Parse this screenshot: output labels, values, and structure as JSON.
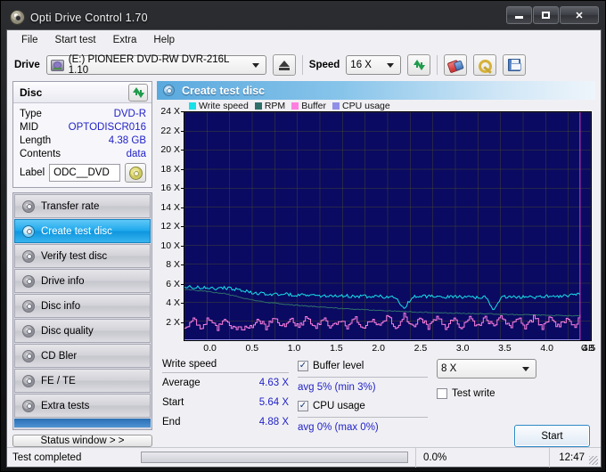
{
  "window": {
    "title": "Opti Drive Control 1.70",
    "minimize": "–",
    "maximize": "□",
    "close": "✕"
  },
  "menu": [
    {
      "label": "File"
    },
    {
      "label": "Start test"
    },
    {
      "label": "Extra"
    },
    {
      "label": "Help"
    }
  ],
  "toolbar": {
    "drive_label": "Drive",
    "drive_value": "(E:)  PIONEER DVD-RW  DVR-216L 1.10",
    "eject_icon": "eject-icon",
    "speed_label": "Speed",
    "speed_value": "16 X",
    "refresh_icon": "refresh-icon",
    "erase_icon": "erase-icon",
    "tools_icon": "tools-icon",
    "save_icon": "save-icon"
  },
  "disc": {
    "header": "Disc",
    "refresh_icon": "refresh-icon",
    "rows": [
      {
        "key": "Type",
        "value": "DVD-R"
      },
      {
        "key": "MID",
        "value": "OPTODISCR016"
      },
      {
        "key": "Length",
        "value": "4.38 GB"
      },
      {
        "key": "Contents",
        "value": "data"
      }
    ],
    "label_key": "Label",
    "label_value": "ODC__DVD",
    "cd_icon": "cd-disc-icon"
  },
  "nav": {
    "items": [
      {
        "label": "Transfer rate",
        "active": false
      },
      {
        "label": "Create test disc",
        "active": true
      },
      {
        "label": "Verify test disc",
        "active": false
      },
      {
        "label": "Drive info",
        "active": false
      },
      {
        "label": "Disc info",
        "active": false
      },
      {
        "label": "Disc quality",
        "active": false
      },
      {
        "label": "CD Bler",
        "active": false
      },
      {
        "label": "FE / TE",
        "active": false
      },
      {
        "label": "Extra tests",
        "active": false
      }
    ],
    "status_window": "Status window > >"
  },
  "main": {
    "header_title": "Create test disc",
    "header_icon": "disc-icon"
  },
  "stats": {
    "write_speed_title": "Write speed",
    "rows": [
      {
        "key": "Average",
        "value": "4.63 X"
      },
      {
        "key": "Start",
        "value": "5.64 X"
      },
      {
        "key": "End",
        "value": "4.88 X"
      }
    ],
    "buffer_label": "Buffer level",
    "buffer_checked": true,
    "buffer_note": "avg 5% (min 3%)",
    "cpu_label": "CPU usage",
    "cpu_checked": true,
    "cpu_note": "avg 0% (max 0%)",
    "speed_select": "8 X",
    "test_write_label": "Test write",
    "test_write_checked": false,
    "start_button": "Start"
  },
  "statusbar": {
    "text": "Test completed",
    "percent": "0.0%",
    "time": "12:47",
    "progress": 0
  },
  "chart_data": {
    "type": "line",
    "title": "Create test disc",
    "xlabel": "GB",
    "ylabel": "X",
    "xlim": [
      0.0,
      4.5
    ],
    "ylim": [
      0,
      24
    ],
    "xticks": [
      0.0,
      0.5,
      1.0,
      1.5,
      2.0,
      2.5,
      3.0,
      3.5,
      4.0,
      4.5
    ],
    "xtick_labels": [
      "0.0",
      "0.5",
      "1.0",
      "1.5",
      "2.0",
      "2.5",
      "3.0",
      "3.5",
      "4.0",
      "4.5"
    ],
    "x_unit": "GB",
    "yticks": [
      2,
      4,
      6,
      8,
      10,
      12,
      14,
      16,
      18,
      20,
      22,
      24
    ],
    "ytick_labels": [
      "2 X",
      "4 X",
      "6 X",
      "8 X",
      "10 X",
      "12 X",
      "14 X",
      "16 X",
      "18 X",
      "20 X",
      "22 X",
      "24 X"
    ],
    "grid": true,
    "plot_background": "#0a0a62",
    "grid_color": "#5a5a1e",
    "legend_position": "top",
    "end_marker_gb": 4.38,
    "end_marker_color": "#e040c0",
    "series": [
      {
        "name": "Write speed",
        "color": "#18e0e8",
        "unit": "X",
        "x": [
          0.0,
          0.09,
          0.18,
          0.27,
          0.36,
          0.45,
          0.54,
          0.63,
          0.72,
          0.81,
          0.9,
          0.99,
          1.08,
          1.17,
          1.26,
          1.35,
          1.44,
          1.53,
          1.62,
          1.71,
          1.8,
          1.89,
          1.98,
          2.07,
          2.16,
          2.25,
          2.34,
          2.43,
          2.52,
          2.61,
          2.7,
          2.79,
          2.88,
          2.97,
          3.06,
          3.15,
          3.24,
          3.33,
          3.42,
          3.51,
          3.6,
          3.69,
          3.78,
          3.87,
          3.96,
          4.05,
          4.14,
          4.23,
          4.32,
          4.38
        ],
        "values": [
          5.64,
          5.6,
          5.52,
          5.58,
          5.45,
          5.5,
          5.4,
          5.3,
          5.05,
          4.95,
          4.85,
          4.8,
          4.9,
          4.78,
          4.7,
          4.82,
          4.75,
          4.65,
          4.72,
          4.6,
          4.68,
          4.58,
          4.66,
          4.55,
          4.62,
          4.52,
          4.6,
          3.3,
          4.55,
          4.7,
          4.6,
          4.66,
          4.56,
          4.62,
          4.54,
          4.6,
          4.5,
          4.58,
          3.2,
          4.56,
          4.62,
          4.52,
          4.6,
          4.5,
          4.58,
          4.68,
          4.6,
          4.7,
          4.8,
          4.88
        ]
      },
      {
        "name": "RPM",
        "color": "#2f6f6a",
        "unit": "X",
        "x": [
          0.0,
          0.09,
          0.18,
          0.27,
          0.36,
          0.45,
          0.54,
          0.63,
          0.72,
          0.81,
          0.9,
          0.99,
          1.08,
          1.17,
          1.26,
          1.35,
          1.44,
          1.53,
          1.62,
          1.71,
          1.8,
          1.89,
          1.98,
          2.07,
          2.16,
          2.25,
          2.34,
          2.43,
          2.52,
          2.61,
          2.7,
          2.79,
          2.88,
          2.97,
          3.06,
          3.15,
          3.24,
          3.33,
          3.42,
          3.51,
          3.6,
          3.69,
          3.78,
          3.87,
          3.96,
          4.05,
          4.14,
          4.23,
          4.32,
          4.38
        ],
        "values": [
          5.35,
          5.3,
          5.2,
          5.1,
          5.0,
          4.9,
          4.7,
          4.5,
          4.3,
          4.15,
          4.0,
          3.9,
          3.82,
          3.74,
          3.66,
          3.6,
          3.54,
          3.48,
          3.42,
          3.36,
          3.3,
          3.26,
          3.22,
          3.18,
          3.14,
          3.1,
          3.06,
          3.02,
          2.98,
          2.96,
          2.92,
          2.9,
          2.88,
          2.86,
          2.84,
          2.82,
          2.8,
          2.78,
          2.76,
          2.74,
          2.72,
          2.7,
          2.68,
          2.66,
          2.64,
          2.62,
          2.6,
          2.58,
          2.56,
          2.55
        ]
      },
      {
        "name": "Buffer",
        "color": "#ff7fe0",
        "unit": "X",
        "note": "buffer level oscillating between ~1.2X and ~2.6X equivalent scale",
        "x": [
          0.0,
          0.09,
          0.18,
          0.27,
          0.36,
          0.45,
          0.54,
          0.63,
          0.72,
          0.81,
          0.9,
          0.99,
          1.08,
          1.17,
          1.26,
          1.35,
          1.44,
          1.53,
          1.62,
          1.71,
          1.8,
          1.89,
          1.98,
          2.07,
          2.16,
          2.25,
          2.34,
          2.43,
          2.52,
          2.61,
          2.7,
          2.79,
          2.88,
          2.97,
          3.06,
          3.15,
          3.24,
          3.33,
          3.42,
          3.51,
          3.6,
          3.69,
          3.78,
          3.87,
          3.96,
          4.05,
          4.14,
          4.23,
          4.32,
          4.38
        ],
        "values": [
          1.2,
          2.2,
          1.3,
          2.4,
          1.25,
          2.1,
          1.3,
          1.25,
          1.25,
          2.3,
          1.3,
          2.45,
          1.35,
          2.2,
          1.3,
          2.5,
          1.35,
          2.3,
          1.3,
          2.15,
          1.35,
          2.4,
          1.3,
          2.25,
          1.35,
          2.55,
          1.3,
          2.6,
          1.4,
          2.35,
          1.35,
          2.5,
          1.3,
          2.4,
          1.35,
          2.45,
          1.3,
          2.3,
          1.4,
          2.55,
          1.35,
          2.4,
          1.3,
          2.5,
          1.35,
          2.45,
          1.3,
          2.35,
          1.4,
          2.6
        ]
      },
      {
        "name": "CPU usage",
        "color": "#8f8fe8",
        "unit": "%",
        "x": [
          0.0,
          4.38
        ],
        "values": [
          0.0,
          0.0
        ]
      }
    ]
  }
}
